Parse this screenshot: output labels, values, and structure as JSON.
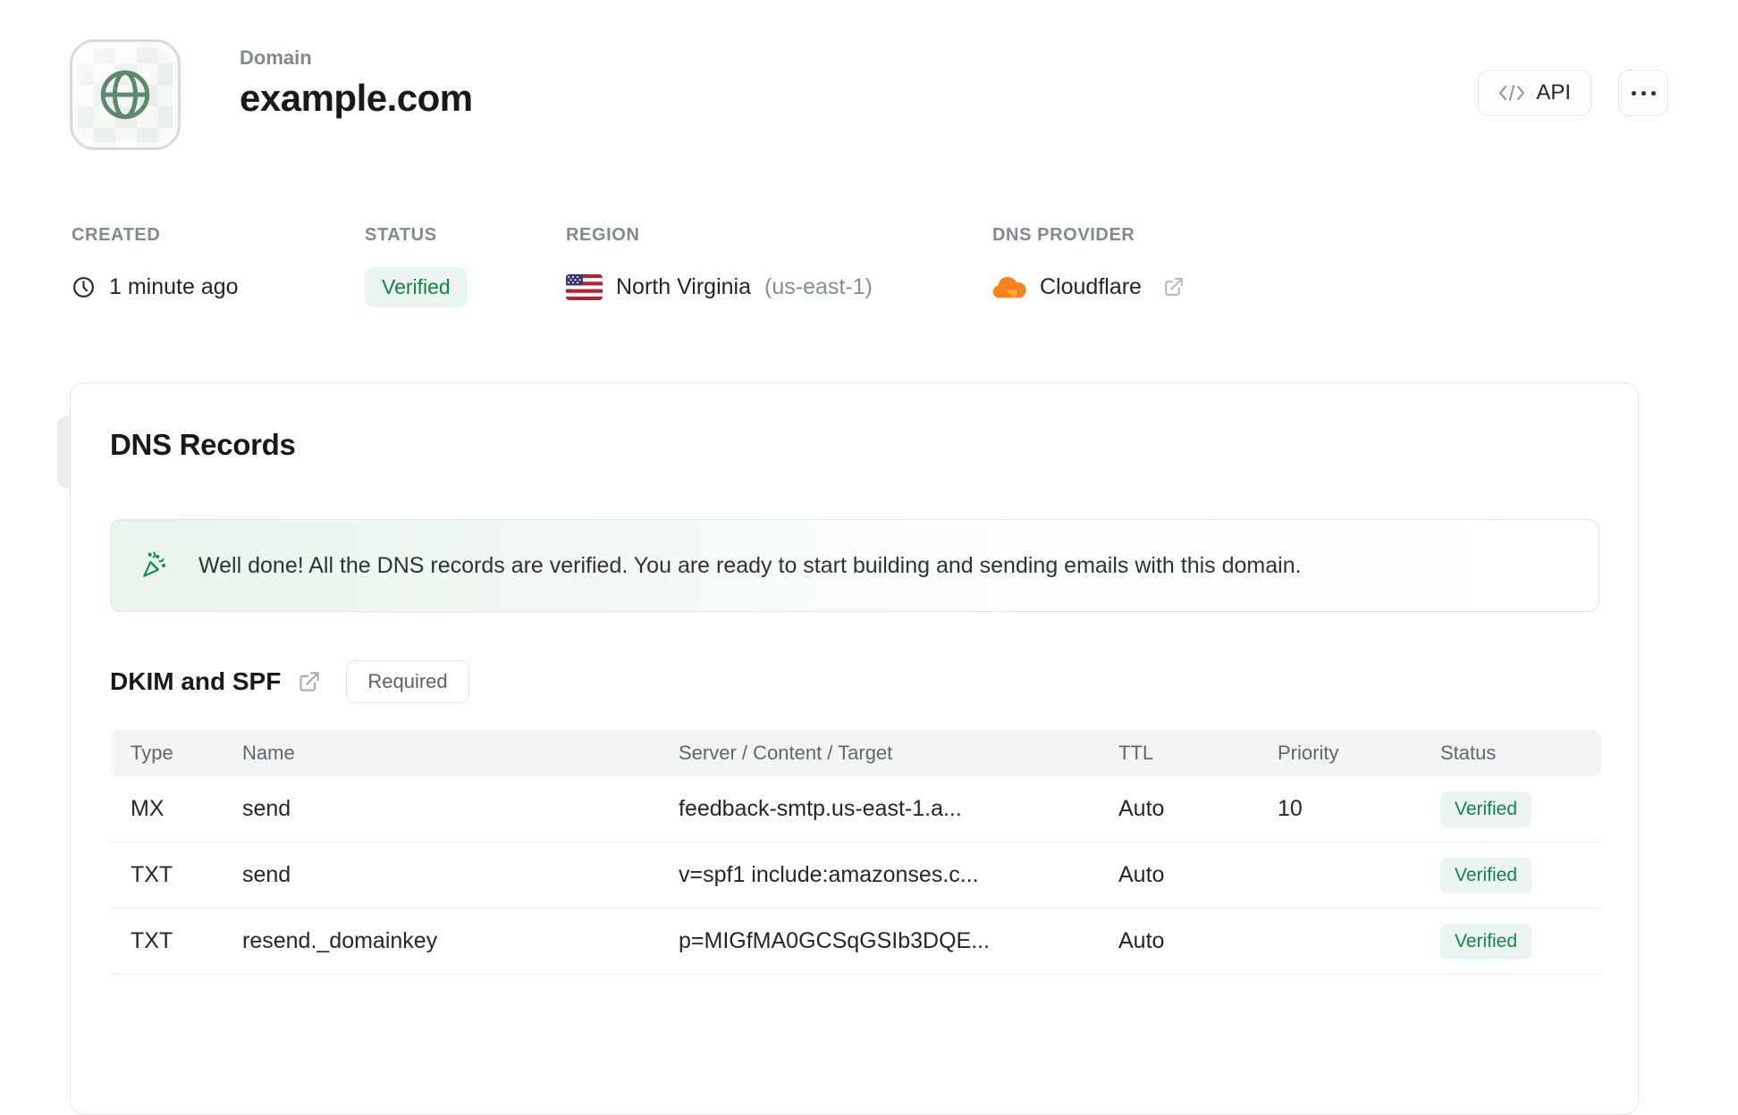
{
  "header": {
    "kicker": "Domain",
    "title": "example.com",
    "api_button_label": "API"
  },
  "meta": {
    "created": {
      "label": "CREATED",
      "value": "1 minute ago"
    },
    "status": {
      "label": "STATUS",
      "value": "Verified"
    },
    "region": {
      "label": "REGION",
      "value": "North Virginia",
      "code": "(us-east-1)"
    },
    "dns_provider": {
      "label": "DNS PROVIDER",
      "value": "Cloudflare"
    }
  },
  "dns_card": {
    "title": "DNS Records",
    "banner_message": "Well done! All the DNS records are verified. You are ready to start building and sending emails with this domain.",
    "section": {
      "title": "DKIM and SPF",
      "badge": "Required"
    },
    "table": {
      "headers": [
        "Type",
        "Name",
        "Server / Content / Target",
        "TTL",
        "Priority",
        "Status"
      ],
      "rows": [
        {
          "type": "MX",
          "name": "send",
          "content": "feedback-smtp.us-east-1.a...",
          "ttl": "Auto",
          "priority": "10",
          "status": "Verified"
        },
        {
          "type": "TXT",
          "name": "send",
          "content": "v=spf1 include:amazonses.c...",
          "ttl": "Auto",
          "priority": "",
          "status": "Verified"
        },
        {
          "type": "TXT",
          "name": "resend._domainkey",
          "content": "p=MIGfMA0GCSqGSIb3DQE...",
          "ttl": "Auto",
          "priority": "",
          "status": "Verified"
        }
      ]
    }
  },
  "icons": {
    "globe": "globe-icon",
    "clock": "clock-icon",
    "us_flag": "us-flag-icon",
    "cloudflare": "cloudflare-cloud-icon",
    "external_link": "external-link-icon",
    "party": "party-popper-icon",
    "code": "code-icon",
    "ellipsis": "ellipsis-icon"
  },
  "colors": {
    "verified_text": "#17804D",
    "verified_bg": "#E9F5EE",
    "globe_green": "#5D8A6E",
    "cloudflare_orange": "#F6821F",
    "banner_green": "#E9F4EC",
    "border": "#E4E7E9",
    "heading": "#17191D",
    "label_gray": "#83898F"
  }
}
